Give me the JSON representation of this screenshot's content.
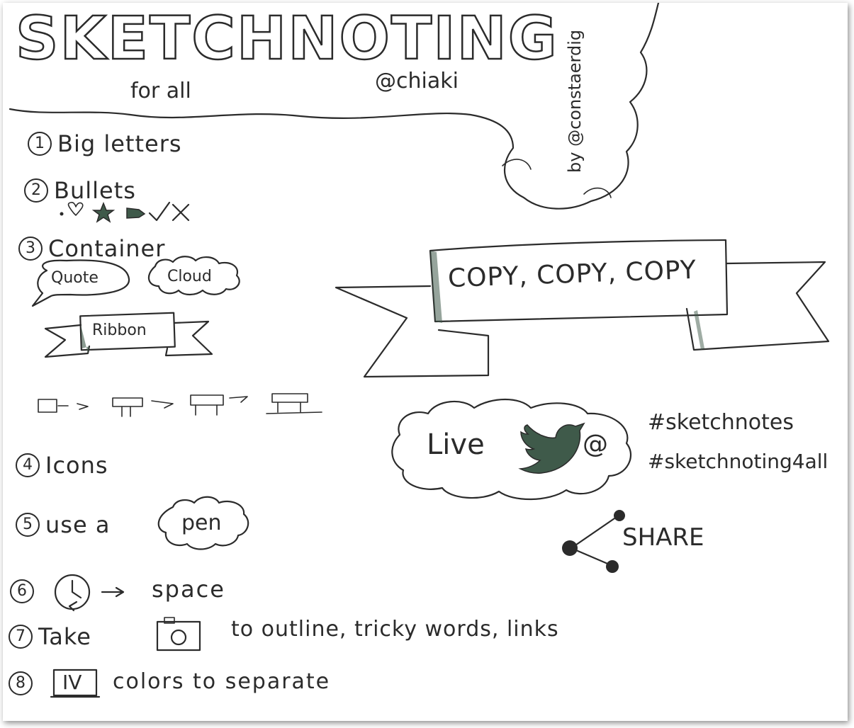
{
  "header": {
    "title": "SKETCHNOTING",
    "subtitle": "for all",
    "handle": "@chiaki",
    "byline": "by @constaerdig"
  },
  "items": [
    {
      "number": "1",
      "text": "Big letters"
    },
    {
      "number": "2",
      "text": "Bullets"
    },
    {
      "number": "3",
      "text": "Container"
    },
    {
      "number": "4",
      "text": "Icons"
    },
    {
      "number": "5",
      "text": "use a"
    },
    {
      "number": "6",
      "text": "space"
    },
    {
      "number": "7",
      "text": "Take"
    },
    {
      "number": "8",
      "text": "colors to separate"
    }
  ],
  "containers": {
    "quote": "Quote",
    "cloud": "Cloud",
    "ribbon": "Ribbon"
  },
  "item5_cloud_word": "pen",
  "item7_rest": "to outline, tricky words, links",
  "item8_box": "IV",
  "banner": {
    "text": "COPY, COPY, COPY"
  },
  "live_cloud": {
    "live": "Live",
    "at": "@"
  },
  "hashtags": [
    "#sketchnotes",
    "#sketchnoting4all"
  ],
  "share": {
    "label": "SHARE"
  },
  "colors": {
    "ink": "#2b2b2b",
    "paper": "#ffffff",
    "accent_green": "#3f5a4a"
  },
  "icons": [
    "heart-icon",
    "star-icon",
    "arrow-icon",
    "check-icon",
    "cross-icon",
    "twitter-bird-icon",
    "clock-icon",
    "camera-icon",
    "share-icon"
  ]
}
